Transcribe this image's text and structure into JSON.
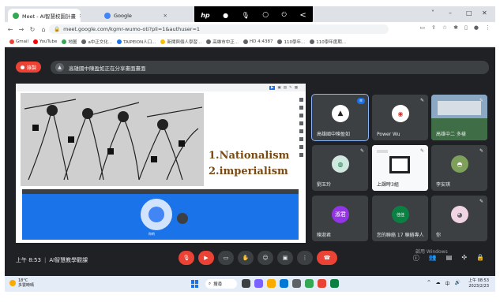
{
  "browser": {
    "tabs": [
      {
        "label": "Meet - AI智慧校園計畫",
        "active": true
      },
      {
        "label": "Google",
        "active": false
      }
    ],
    "window_controls": [
      "˅",
      "–",
      "□",
      "✕"
    ],
    "overlay_icons": [
      "hp",
      "●",
      "🎙",
      "○",
      "⏻",
      "<"
    ],
    "url": "meet.google.com/kgmr-wumo-oti?pli=1&authuser=1",
    "bookmarks": [
      "Gmail",
      "YouTube",
      "地圖",
      "a中正文化...",
      "TAIPEION人口...",
      "新聞與個人學習...",
      "高雄市中正...",
      "HD 4:4387",
      "110學年...",
      "110學年度期..."
    ]
  },
  "meet": {
    "rec_label": "錄製",
    "presenting_text": "高雄國中陳盈如正在分享畫面畫面",
    "presentation": {
      "caption_line1": "1.Nationalism",
      "caption_line2": "2.imperialism",
      "embedded_label": "你的"
    },
    "participants": [
      {
        "name": "高雄國中陳盈如",
        "initial": "",
        "color": "#ffffff",
        "selected": true
      },
      {
        "name": "Power Wu",
        "initial": "",
        "color": "#ffffff",
        "selected": false
      },
      {
        "name": "高雄中二 多樣",
        "initial": "",
        "color": "#6b8fb5",
        "selected": false
      },
      {
        "name": "劉玉玲",
        "initial": "",
        "color": "#cfe8e0",
        "selected": false
      },
      {
        "name": "上課時3組",
        "initial": "",
        "color": "#ffffff",
        "selected": false
      },
      {
        "name": "李安琪",
        "initial": "",
        "color": "#7ea05a",
        "selected": false
      },
      {
        "name": "陳淑君",
        "initial": "淑君",
        "color": "#9334e6",
        "selected": false
      },
      {
        "name": "您的聯絡 17 聯絡專人",
        "initial": "佳佳",
        "color": "#0b8043",
        "selected": false
      },
      {
        "name": "你",
        "initial": "",
        "color": "#f1d4e4",
        "selected": false
      }
    ],
    "time": "上午 8:53",
    "meeting_name": "AI智慧教學觀課",
    "activate_windows": "啟用 Windows"
  },
  "taskbar": {
    "weather_temp": "18°C",
    "weather_desc": "多雲時晴",
    "search_label": "搜尋",
    "clock_time": "上午 08:53",
    "clock_date": "2023/2/23",
    "tray_icons": [
      "^",
      "☁",
      "中",
      "🔊"
    ]
  }
}
